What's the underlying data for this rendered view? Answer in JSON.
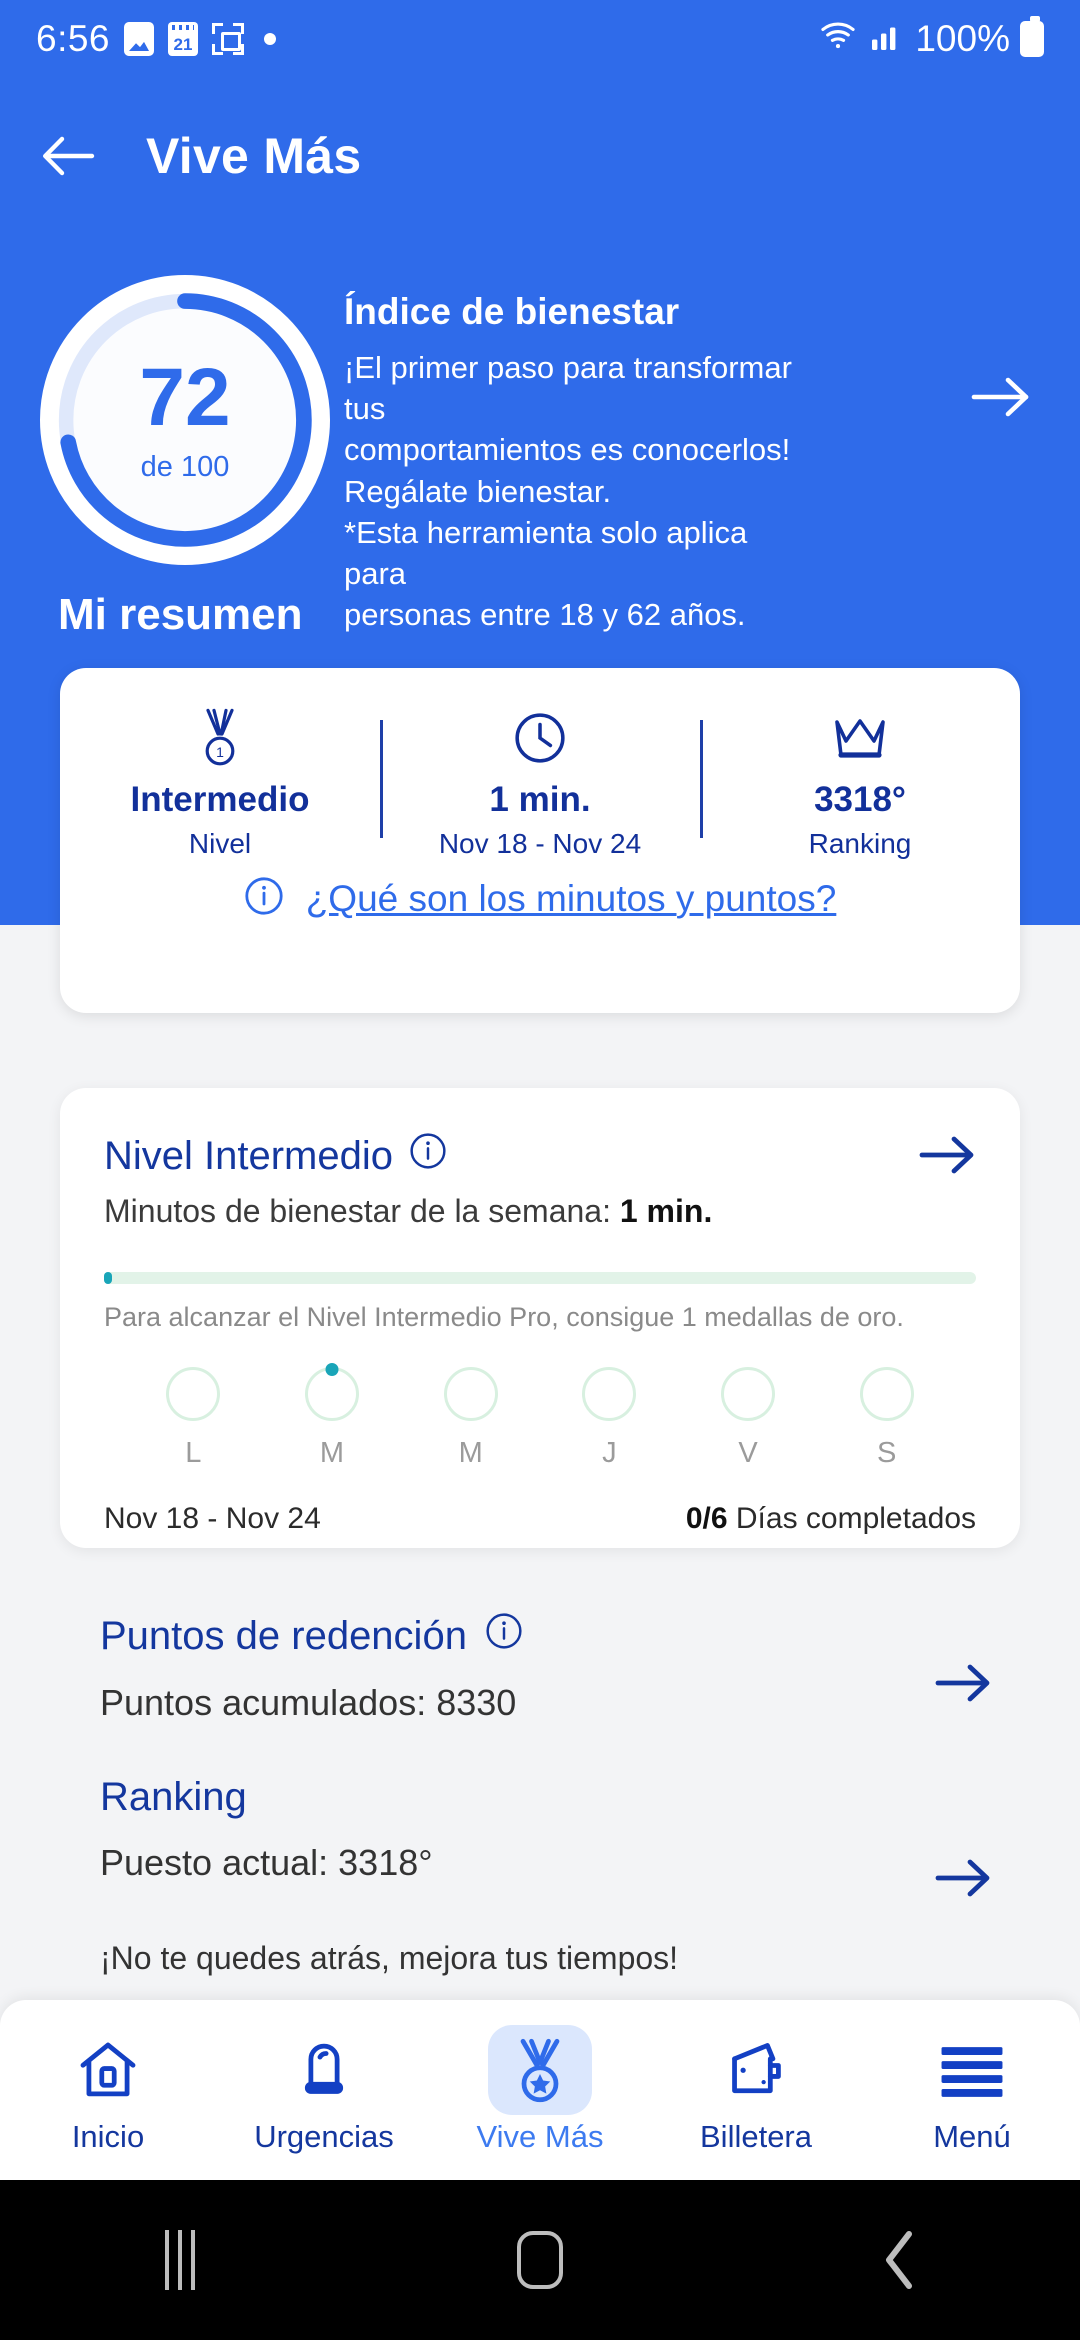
{
  "status_bar": {
    "time": "6:56",
    "battery_percent": "100%",
    "icons": [
      "photo-icon",
      "calendar-icon",
      "screen-capture-icon",
      "dot-icon",
      "wifi-icon",
      "signal-icon",
      "battery-icon"
    ],
    "calendar_day": "21"
  },
  "app_bar": {
    "back_label": "back-arrow",
    "title": "Vive Más"
  },
  "hero": {
    "score": "72",
    "score_of": "de 100",
    "score_percent": 72,
    "title": "Índice de bienestar",
    "paragraph": "¡El primer paso para transformar tus comportamientos es conocerlos! Regálate bienestar.\n*Esta herramienta solo aplica para personas entre 18 y 62 años.",
    "paragraph_lines": [
      "¡El primer paso para transformar tus",
      "comportamientos es conocerlos!",
      "Regálate bienestar.",
      "*Esta herramienta solo aplica para",
      "personas entre 18 y 62 años."
    ]
  },
  "summary": {
    "heading": "Mi resumen",
    "items": [
      {
        "icon": "medal-icon",
        "value": "Intermedio",
        "label": "Nivel"
      },
      {
        "icon": "clock-icon",
        "value": "1 min.",
        "label": "Nov 18 - Nov 24"
      },
      {
        "icon": "crown-icon",
        "value": "3318°",
        "label": "Ranking"
      }
    ],
    "link_label": "¿Qué son los minutos y puntos?"
  },
  "level_card": {
    "title": "Nivel Intermedio",
    "subtitle_prefix": "Minutos de bienestar de la semana: ",
    "subtitle_value": "1 min.",
    "progress_percent": 1,
    "hint": "Para alcanzar el Nivel Intermedio Pro, consigue 1 medallas de oro.",
    "days": [
      {
        "label": "L",
        "active": false
      },
      {
        "label": "M",
        "active": true
      },
      {
        "label": "M",
        "active": false
      },
      {
        "label": "J",
        "active": false
      },
      {
        "label": "V",
        "active": false
      },
      {
        "label": "S",
        "active": false
      }
    ],
    "date_range": "Nov 18 - Nov 24",
    "completed_count": "0/6",
    "completed_label": " Días completados"
  },
  "points_section": {
    "title": "Puntos de redención",
    "subtitle": "Puntos acumulados: 8330"
  },
  "ranking_section": {
    "title": "Ranking",
    "subtitle": "Puesto actual: 3318°",
    "note": "¡No te quedes atrás, mejora tus tiempos!"
  },
  "bottom_nav": {
    "items": [
      {
        "icon": "home-icon",
        "label": "Inicio",
        "active": false
      },
      {
        "icon": "ambulance-light-icon",
        "label": "Urgencias",
        "active": false
      },
      {
        "icon": "medal-icon",
        "label": "Vive Más",
        "active": true
      },
      {
        "icon": "wallet-icon",
        "label": "Billetera",
        "active": false
      },
      {
        "icon": "hamburger-menu-icon",
        "label": "Menú",
        "active": false
      }
    ]
  },
  "system_nav": {
    "recents": "recents-icon",
    "home": "home-pill-icon",
    "back": "back-chevron-icon"
  },
  "colors": {
    "brand_blue": "#2f6bea",
    "navy": "#14379e",
    "accent_teal": "#19a5b8",
    "track_green": "#e2f3e8",
    "page_bg": "#f3f4f6"
  }
}
